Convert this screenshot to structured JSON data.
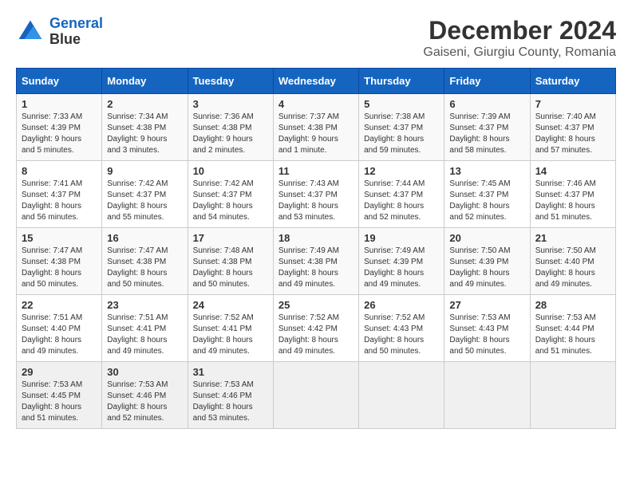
{
  "header": {
    "logo_line1": "General",
    "logo_line2": "Blue",
    "title": "December 2024",
    "subtitle": "Gaiseni, Giurgiu County, Romania"
  },
  "columns": [
    "Sunday",
    "Monday",
    "Tuesday",
    "Wednesday",
    "Thursday",
    "Friday",
    "Saturday"
  ],
  "weeks": [
    [
      {
        "day": "1",
        "sunrise": "7:33 AM",
        "sunset": "4:39 PM",
        "daylight": "9 hours and 5 minutes."
      },
      {
        "day": "2",
        "sunrise": "7:34 AM",
        "sunset": "4:38 PM",
        "daylight": "9 hours and 3 minutes."
      },
      {
        "day": "3",
        "sunrise": "7:36 AM",
        "sunset": "4:38 PM",
        "daylight": "9 hours and 2 minutes."
      },
      {
        "day": "4",
        "sunrise": "7:37 AM",
        "sunset": "4:38 PM",
        "daylight": "9 hours and 1 minute."
      },
      {
        "day": "5",
        "sunrise": "7:38 AM",
        "sunset": "4:37 PM",
        "daylight": "8 hours and 59 minutes."
      },
      {
        "day": "6",
        "sunrise": "7:39 AM",
        "sunset": "4:37 PM",
        "daylight": "8 hours and 58 minutes."
      },
      {
        "day": "7",
        "sunrise": "7:40 AM",
        "sunset": "4:37 PM",
        "daylight": "8 hours and 57 minutes."
      }
    ],
    [
      {
        "day": "8",
        "sunrise": "7:41 AM",
        "sunset": "4:37 PM",
        "daylight": "8 hours and 56 minutes."
      },
      {
        "day": "9",
        "sunrise": "7:42 AM",
        "sunset": "4:37 PM",
        "daylight": "8 hours and 55 minutes."
      },
      {
        "day": "10",
        "sunrise": "7:42 AM",
        "sunset": "4:37 PM",
        "daylight": "8 hours and 54 minutes."
      },
      {
        "day": "11",
        "sunrise": "7:43 AM",
        "sunset": "4:37 PM",
        "daylight": "8 hours and 53 minutes."
      },
      {
        "day": "12",
        "sunrise": "7:44 AM",
        "sunset": "4:37 PM",
        "daylight": "8 hours and 52 minutes."
      },
      {
        "day": "13",
        "sunrise": "7:45 AM",
        "sunset": "4:37 PM",
        "daylight": "8 hours and 52 minutes."
      },
      {
        "day": "14",
        "sunrise": "7:46 AM",
        "sunset": "4:37 PM",
        "daylight": "8 hours and 51 minutes."
      }
    ],
    [
      {
        "day": "15",
        "sunrise": "7:47 AM",
        "sunset": "4:38 PM",
        "daylight": "8 hours and 50 minutes."
      },
      {
        "day": "16",
        "sunrise": "7:47 AM",
        "sunset": "4:38 PM",
        "daylight": "8 hours and 50 minutes."
      },
      {
        "day": "17",
        "sunrise": "7:48 AM",
        "sunset": "4:38 PM",
        "daylight": "8 hours and 50 minutes."
      },
      {
        "day": "18",
        "sunrise": "7:49 AM",
        "sunset": "4:38 PM",
        "daylight": "8 hours and 49 minutes."
      },
      {
        "day": "19",
        "sunrise": "7:49 AM",
        "sunset": "4:39 PM",
        "daylight": "8 hours and 49 minutes."
      },
      {
        "day": "20",
        "sunrise": "7:50 AM",
        "sunset": "4:39 PM",
        "daylight": "8 hours and 49 minutes."
      },
      {
        "day": "21",
        "sunrise": "7:50 AM",
        "sunset": "4:40 PM",
        "daylight": "8 hours and 49 minutes."
      }
    ],
    [
      {
        "day": "22",
        "sunrise": "7:51 AM",
        "sunset": "4:40 PM",
        "daylight": "8 hours and 49 minutes."
      },
      {
        "day": "23",
        "sunrise": "7:51 AM",
        "sunset": "4:41 PM",
        "daylight": "8 hours and 49 minutes."
      },
      {
        "day": "24",
        "sunrise": "7:52 AM",
        "sunset": "4:41 PM",
        "daylight": "8 hours and 49 minutes."
      },
      {
        "day": "25",
        "sunrise": "7:52 AM",
        "sunset": "4:42 PM",
        "daylight": "8 hours and 49 minutes."
      },
      {
        "day": "26",
        "sunrise": "7:52 AM",
        "sunset": "4:43 PM",
        "daylight": "8 hours and 50 minutes."
      },
      {
        "day": "27",
        "sunrise": "7:53 AM",
        "sunset": "4:43 PM",
        "daylight": "8 hours and 50 minutes."
      },
      {
        "day": "28",
        "sunrise": "7:53 AM",
        "sunset": "4:44 PM",
        "daylight": "8 hours and 51 minutes."
      }
    ],
    [
      {
        "day": "29",
        "sunrise": "7:53 AM",
        "sunset": "4:45 PM",
        "daylight": "8 hours and 51 minutes."
      },
      {
        "day": "30",
        "sunrise": "7:53 AM",
        "sunset": "4:46 PM",
        "daylight": "8 hours and 52 minutes."
      },
      {
        "day": "31",
        "sunrise": "7:53 AM",
        "sunset": "4:46 PM",
        "daylight": "8 hours and 53 minutes."
      },
      null,
      null,
      null,
      null
    ]
  ]
}
